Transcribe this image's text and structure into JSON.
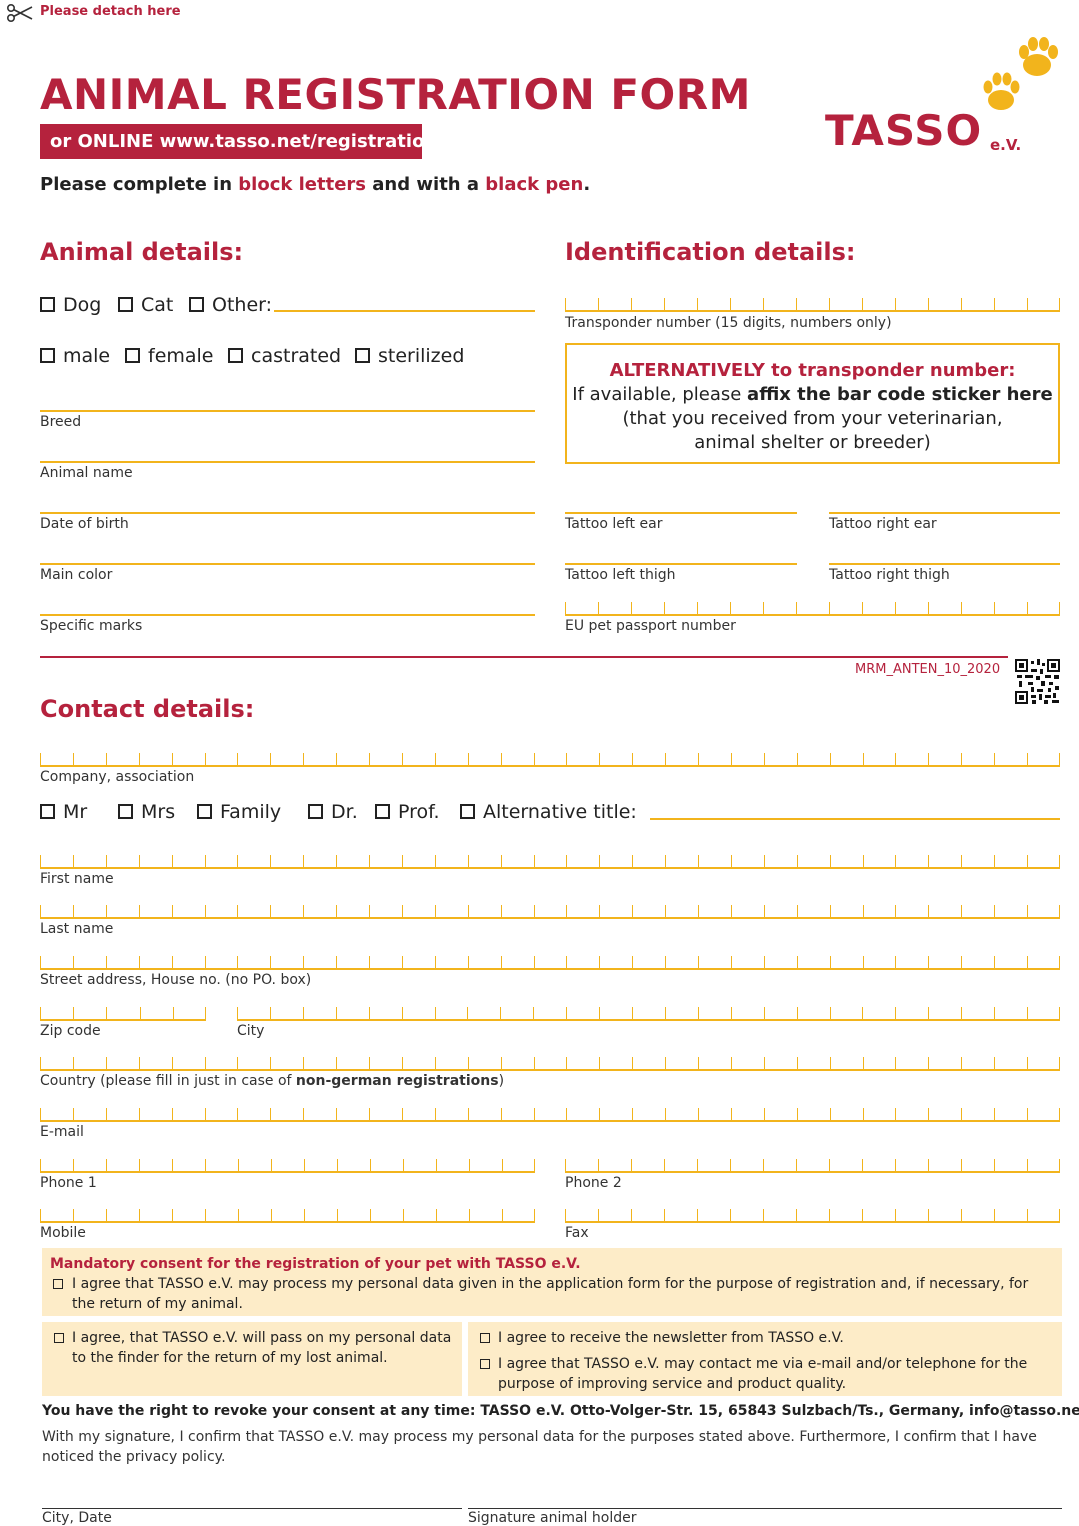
{
  "header": {
    "detach_text": "Please detach here",
    "title": "ANIMAL REGISTRATION FORM",
    "online_banner": "or ONLINE www.tasso.net/registration",
    "instruction_prefix": "Please complete in ",
    "instruction_red1": "block letters",
    "instruction_mid": " and with a ",
    "instruction_red2": "black pen",
    "instruction_suffix": ".",
    "logo_text": "TASSO",
    "logo_suffix": "e.V."
  },
  "animal": {
    "heading": "Animal details:",
    "species": [
      "Dog",
      "Cat",
      "Other:"
    ],
    "sex": [
      "male",
      "female",
      "castrated",
      "sterilized"
    ],
    "fields": [
      "Breed",
      "Animal name",
      "Date of birth",
      "Main color",
      "Specific marks"
    ]
  },
  "identification": {
    "heading": "Identification details:",
    "transponder_label": "Transponder number (15 digits, numbers only)",
    "alt_title": "ALTERNATIVELY to transponder number:",
    "alt_line1_prefix": "If available, please ",
    "alt_line1_bold": "affix the bar code sticker here",
    "alt_line2": "(that you received from your veterinarian,",
    "alt_line3": "animal shelter or breeder)",
    "tattoo_left_ear": "Tattoo left ear",
    "tattoo_right_ear": "Tattoo right ear",
    "tattoo_left_thigh": "Tattoo left thigh",
    "tattoo_right_thigh": "Tattoo right thigh",
    "passport_label": "EU pet passport number"
  },
  "form_code": "MRM_ANTEN_10_2020",
  "contact": {
    "heading": "Contact details:",
    "company_label": "Company, association",
    "titles": [
      "Mr",
      "Mrs",
      "Family",
      "Dr.",
      "Prof.",
      "Alternative title:"
    ],
    "first_name": "First name",
    "last_name": "Last name",
    "street": "Street address, House no. (no PO. box)",
    "zip": "Zip code",
    "city": "City",
    "country_prefix": "Country (please fill in just in case of ",
    "country_bold": "non-german registrations",
    "country_suffix": ")",
    "email": "E-mail",
    "phone1": "Phone 1",
    "phone2": "Phone 2",
    "mobile": "Mobile",
    "fax": "Fax"
  },
  "consent": {
    "mandatory_title": "Mandatory consent for the registration of your pet with TASSO e.V.",
    "mandatory_text": "I agree that TASSO e.V. may process my personal data given in the application form for the purpose of registration and, if necessary, for the return of my animal.",
    "finder_text": "I agree, that TASSO e.V. will pass on my personal data to the finder for the return of my lost animal.",
    "newsletter_text": "I agree to receive the newsletter from TASSO e.V.",
    "contact_text": "I agree that TASSO e.V. may contact me via e-mail and/or telephone for the purpose of improving service and product quality.",
    "revoke_text": "You have the right to revoke your consent at any time: TASSO e.V. Otto-Volger-Str. 15, 65843 Sulzbach/Ts., Germany, info@tasso.net",
    "signature_text": "With my signature, I confirm that TASSO e.V. may process my personal data for the purposes stated above. Furthermore, I confirm that I have noticed the privacy policy."
  },
  "signature": {
    "city_date": "City, Date",
    "holder": "Signature animal holder"
  }
}
